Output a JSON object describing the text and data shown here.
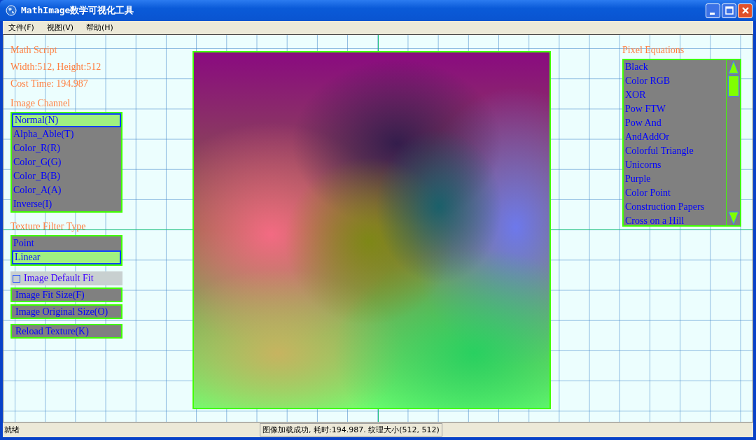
{
  "window": {
    "title": "MathImage数学可视化工具"
  },
  "menu": [
    "文件(F)",
    "视图(V)",
    "帮助(H)"
  ],
  "info": {
    "heading": "Math Script",
    "size": "Width:512, Height:512",
    "cost": "Cost Time: 194.987"
  },
  "image_channel": {
    "label": "Image Channel",
    "items": [
      {
        "label": "Normal(N)",
        "selected": true
      },
      {
        "label": "Alpha_Able(T)",
        "selected": false
      },
      {
        "label": "Color_R(R)",
        "selected": false
      },
      {
        "label": "Color_G(G)",
        "selected": false
      },
      {
        "label": "Color_B(B)",
        "selected": false
      },
      {
        "label": "Color_A(A)",
        "selected": false
      },
      {
        "label": "Inverse(I)",
        "selected": false
      }
    ]
  },
  "texture_filter": {
    "label": "Texture Filter Type",
    "items": [
      {
        "label": "Point",
        "selected": false
      },
      {
        "label": "Linear",
        "selected": true
      }
    ]
  },
  "default_fit": {
    "label": "Image Default Fit",
    "checked": false
  },
  "buttons": [
    "Image Fit Size(F)",
    "Image Original Size(O)",
    "Reload Texture(K)"
  ],
  "pixel_equations": {
    "label": "Pixel Equations",
    "items": [
      {
        "label": "Black",
        "selected": false
      },
      {
        "label": "Color RGB",
        "selected": false
      },
      {
        "label": "XOR",
        "selected": false
      },
      {
        "label": "Pow FTW",
        "selected": false
      },
      {
        "label": "Pow And",
        "selected": false
      },
      {
        "label": "AndAddOr",
        "selected": false
      },
      {
        "label": "Colorful Triangle",
        "selected": false
      },
      {
        "label": "Unicorns",
        "selected": false
      },
      {
        "label": "Purple",
        "selected": false
      },
      {
        "label": "Color Point",
        "selected": false
      },
      {
        "label": "Construction Papers",
        "selected": false
      },
      {
        "label": "Cross on a Hill",
        "selected": false
      }
    ]
  },
  "status_bar": {
    "left": "就绪",
    "right": "图像加载成功, 耗时:194.987. 纹理大小(512, 512)"
  }
}
